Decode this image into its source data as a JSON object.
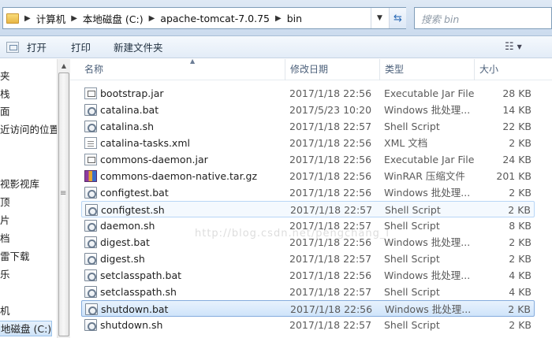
{
  "address_bar": {
    "breadcrumbs": [
      "计算机",
      "本地磁盘 (C:)",
      "apache-tomcat-7.0.75",
      "bin"
    ],
    "search_placeholder": "搜索 bin"
  },
  "toolbar": {
    "open_label": "打开",
    "print_label": "打印",
    "new_folder_label": "新建文件夹"
  },
  "nav_pane": {
    "items": [
      {
        "label": "夹",
        "selected": false
      },
      {
        "label": "栈",
        "selected": false
      },
      {
        "label": "面",
        "selected": false
      },
      {
        "label": "近访问的位置",
        "selected": false
      },
      {
        "label": "",
        "selected": false
      },
      {
        "label": "视影视库",
        "selected": false
      },
      {
        "label": "顶",
        "selected": false
      },
      {
        "label": "片",
        "selected": false
      },
      {
        "label": "档",
        "selected": false
      },
      {
        "label": "雷下载",
        "selected": false
      },
      {
        "label": "乐",
        "selected": false
      },
      {
        "label": "",
        "selected": false
      },
      {
        "label": "机",
        "selected": false
      },
      {
        "label": "地磁盘 (C:)",
        "selected": true
      }
    ]
  },
  "file_list": {
    "columns": {
      "name": "名称",
      "date": "修改日期",
      "type": "类型",
      "size": "大小"
    },
    "watermark": "http://blog.csdn.net/pengchang_l",
    "rows": [
      {
        "icon": "jar-file-icon",
        "name": "bootstrap.jar",
        "date": "2017/1/18 22:56",
        "type": "Executable Jar File",
        "size": "28 KB",
        "state": ""
      },
      {
        "icon": "batch-file-icon",
        "name": "catalina.bat",
        "date": "2017/5/23 10:20",
        "type": "Windows 批处理...",
        "size": "14 KB",
        "state": ""
      },
      {
        "icon": "shell-script-icon",
        "name": "catalina.sh",
        "date": "2017/1/18 22:57",
        "type": "Shell Script",
        "size": "22 KB",
        "state": ""
      },
      {
        "icon": "xml-file-icon",
        "name": "catalina-tasks.xml",
        "date": "2017/1/18 22:56",
        "type": "XML 文档",
        "size": "2 KB",
        "state": ""
      },
      {
        "icon": "jar-file-icon",
        "name": "commons-daemon.jar",
        "date": "2017/1/18 22:56",
        "type": "Executable Jar File",
        "size": "24 KB",
        "state": ""
      },
      {
        "icon": "rar-archive-icon",
        "name": "commons-daemon-native.tar.gz",
        "date": "2017/1/18 22:56",
        "type": "WinRAR 压缩文件",
        "size": "201 KB",
        "state": ""
      },
      {
        "icon": "batch-file-icon",
        "name": "configtest.bat",
        "date": "2017/1/18 22:56",
        "type": "Windows 批处理...",
        "size": "2 KB",
        "state": ""
      },
      {
        "icon": "shell-script-icon",
        "name": "configtest.sh",
        "date": "2017/1/18 22:57",
        "type": "Shell Script",
        "size": "2 KB",
        "state": "hover"
      },
      {
        "icon": "shell-script-icon",
        "name": "daemon.sh",
        "date": "2017/1/18 22:57",
        "type": "Shell Script",
        "size": "8 KB",
        "state": ""
      },
      {
        "icon": "batch-file-icon",
        "name": "digest.bat",
        "date": "2017/1/18 22:56",
        "type": "Windows 批处理...",
        "size": "2 KB",
        "state": ""
      },
      {
        "icon": "shell-script-icon",
        "name": "digest.sh",
        "date": "2017/1/18 22:57",
        "type": "Shell Script",
        "size": "2 KB",
        "state": ""
      },
      {
        "icon": "batch-file-icon",
        "name": "setclasspath.bat",
        "date": "2017/1/18 22:56",
        "type": "Windows 批处理...",
        "size": "4 KB",
        "state": ""
      },
      {
        "icon": "shell-script-icon",
        "name": "setclasspath.sh",
        "date": "2017/1/18 22:57",
        "type": "Shell Script",
        "size": "4 KB",
        "state": ""
      },
      {
        "icon": "batch-file-icon",
        "name": "shutdown.bat",
        "date": "2017/1/18 22:56",
        "type": "Windows 批处理...",
        "size": "2 KB",
        "state": "selected"
      },
      {
        "icon": "shell-script-icon",
        "name": "shutdown.sh",
        "date": "2017/1/18 22:57",
        "type": "Shell Script",
        "size": "2 KB",
        "state": ""
      }
    ]
  }
}
